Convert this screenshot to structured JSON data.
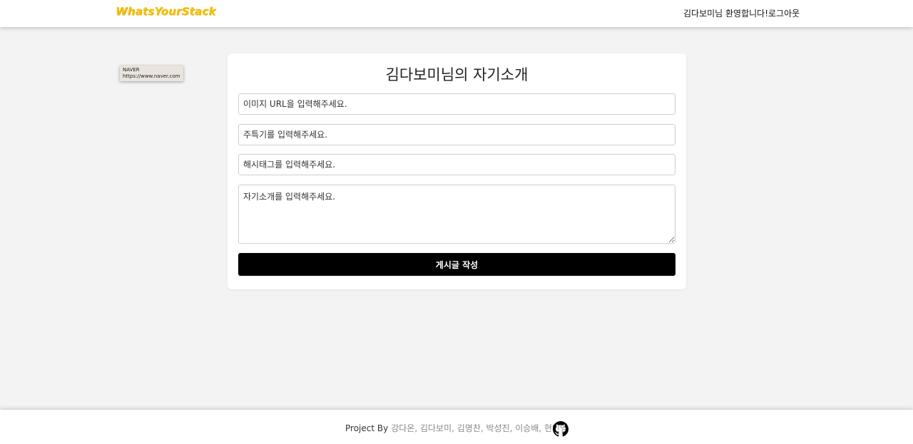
{
  "header": {
    "logo": "WhatsYourStack",
    "welcome": "김다보미님 환영합니다!",
    "logout": "로그아웃"
  },
  "tooltip": {
    "title": "NAVER",
    "url": "https://www.naver.com"
  },
  "form": {
    "title": "김다보미님의 자기소개",
    "image_url_placeholder": "이미지 URL을 입력해주세요.",
    "main_stack_placeholder": "주특기를 입력해주세요.",
    "hashtag_placeholder": "해시태그를 입력해주세요.",
    "intro_placeholder": "자기소개를 입력해주세요.",
    "submit_label": "게시글 작성"
  },
  "footer": {
    "prefix": "Project By",
    "members": "강다온, 김다보미, 김명찬, 박성진, 이승배, 현민영",
    "github_icon": "github-icon"
  },
  "colors": {
    "logo": "#f4c20d",
    "background": "#f3f3f3",
    "button": "#000000"
  }
}
